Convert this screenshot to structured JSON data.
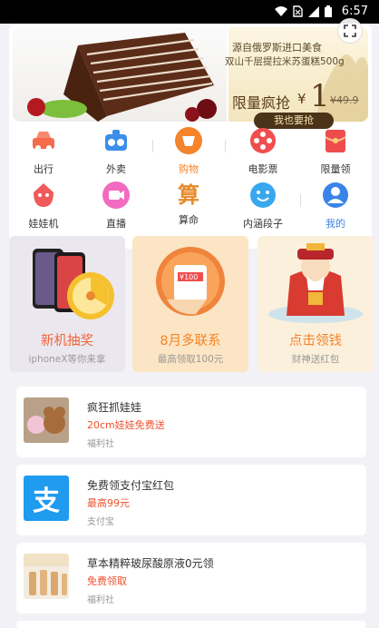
{
  "status_bar": {
    "time": "6:57"
  },
  "banner": {
    "subtitle_line1": "源自俄罗斯进口美食",
    "subtitle_line2": "双山千层提拉米苏蛋糕500g",
    "flash_label": "限量疯抢",
    "currency": "¥",
    "price_big": "1",
    "price_old": "¥49.9",
    "cta": "我也要抢"
  },
  "grid": [
    {
      "label": "出行",
      "icon": "car-icon"
    },
    {
      "label": "外卖",
      "icon": "takeout-icon"
    },
    {
      "label": "购物",
      "icon": "shopping-icon",
      "active": true
    },
    {
      "label": "电影票",
      "icon": "movie-icon"
    },
    {
      "label": "限量领",
      "icon": "red-envelope-icon"
    },
    {
      "label": "娃娃机",
      "icon": "claw-machine-icon"
    },
    {
      "label": "直播",
      "icon": "live-icon"
    },
    {
      "label": "算命",
      "icon": "fortune-icon",
      "glyph": "算"
    },
    {
      "label": "内涵段子",
      "icon": "smiley-icon"
    },
    {
      "label": "我的",
      "icon": "profile-icon"
    }
  ],
  "promos": [
    {
      "title": "新机抽奖",
      "subtitle": "iphoneX等你来拿",
      "title_color": "#f0633a"
    },
    {
      "title": "8月多联系",
      "subtitle": "最高领取100元",
      "title_color": "#f5842a",
      "badge": "¥100"
    },
    {
      "title": "点击领钱",
      "subtitle": "财神送红包",
      "title_color": "#f5842a"
    }
  ],
  "list": [
    {
      "title": "疯狂抓娃娃",
      "highlight": "20cm娃娃免费送",
      "source": "福利社"
    },
    {
      "title": "免费领支付宝红包",
      "highlight": "最高99元",
      "source": "支付宝",
      "thumb_glyph": "支"
    },
    {
      "title": "草本精粹玻尿酸原液0元领",
      "highlight": "免费领取",
      "source": "福利社"
    }
  ],
  "colors": {
    "accent_orange": "#f5842a",
    "highlight_red": "#f0502d",
    "alipay_blue": "#1f9bef"
  }
}
